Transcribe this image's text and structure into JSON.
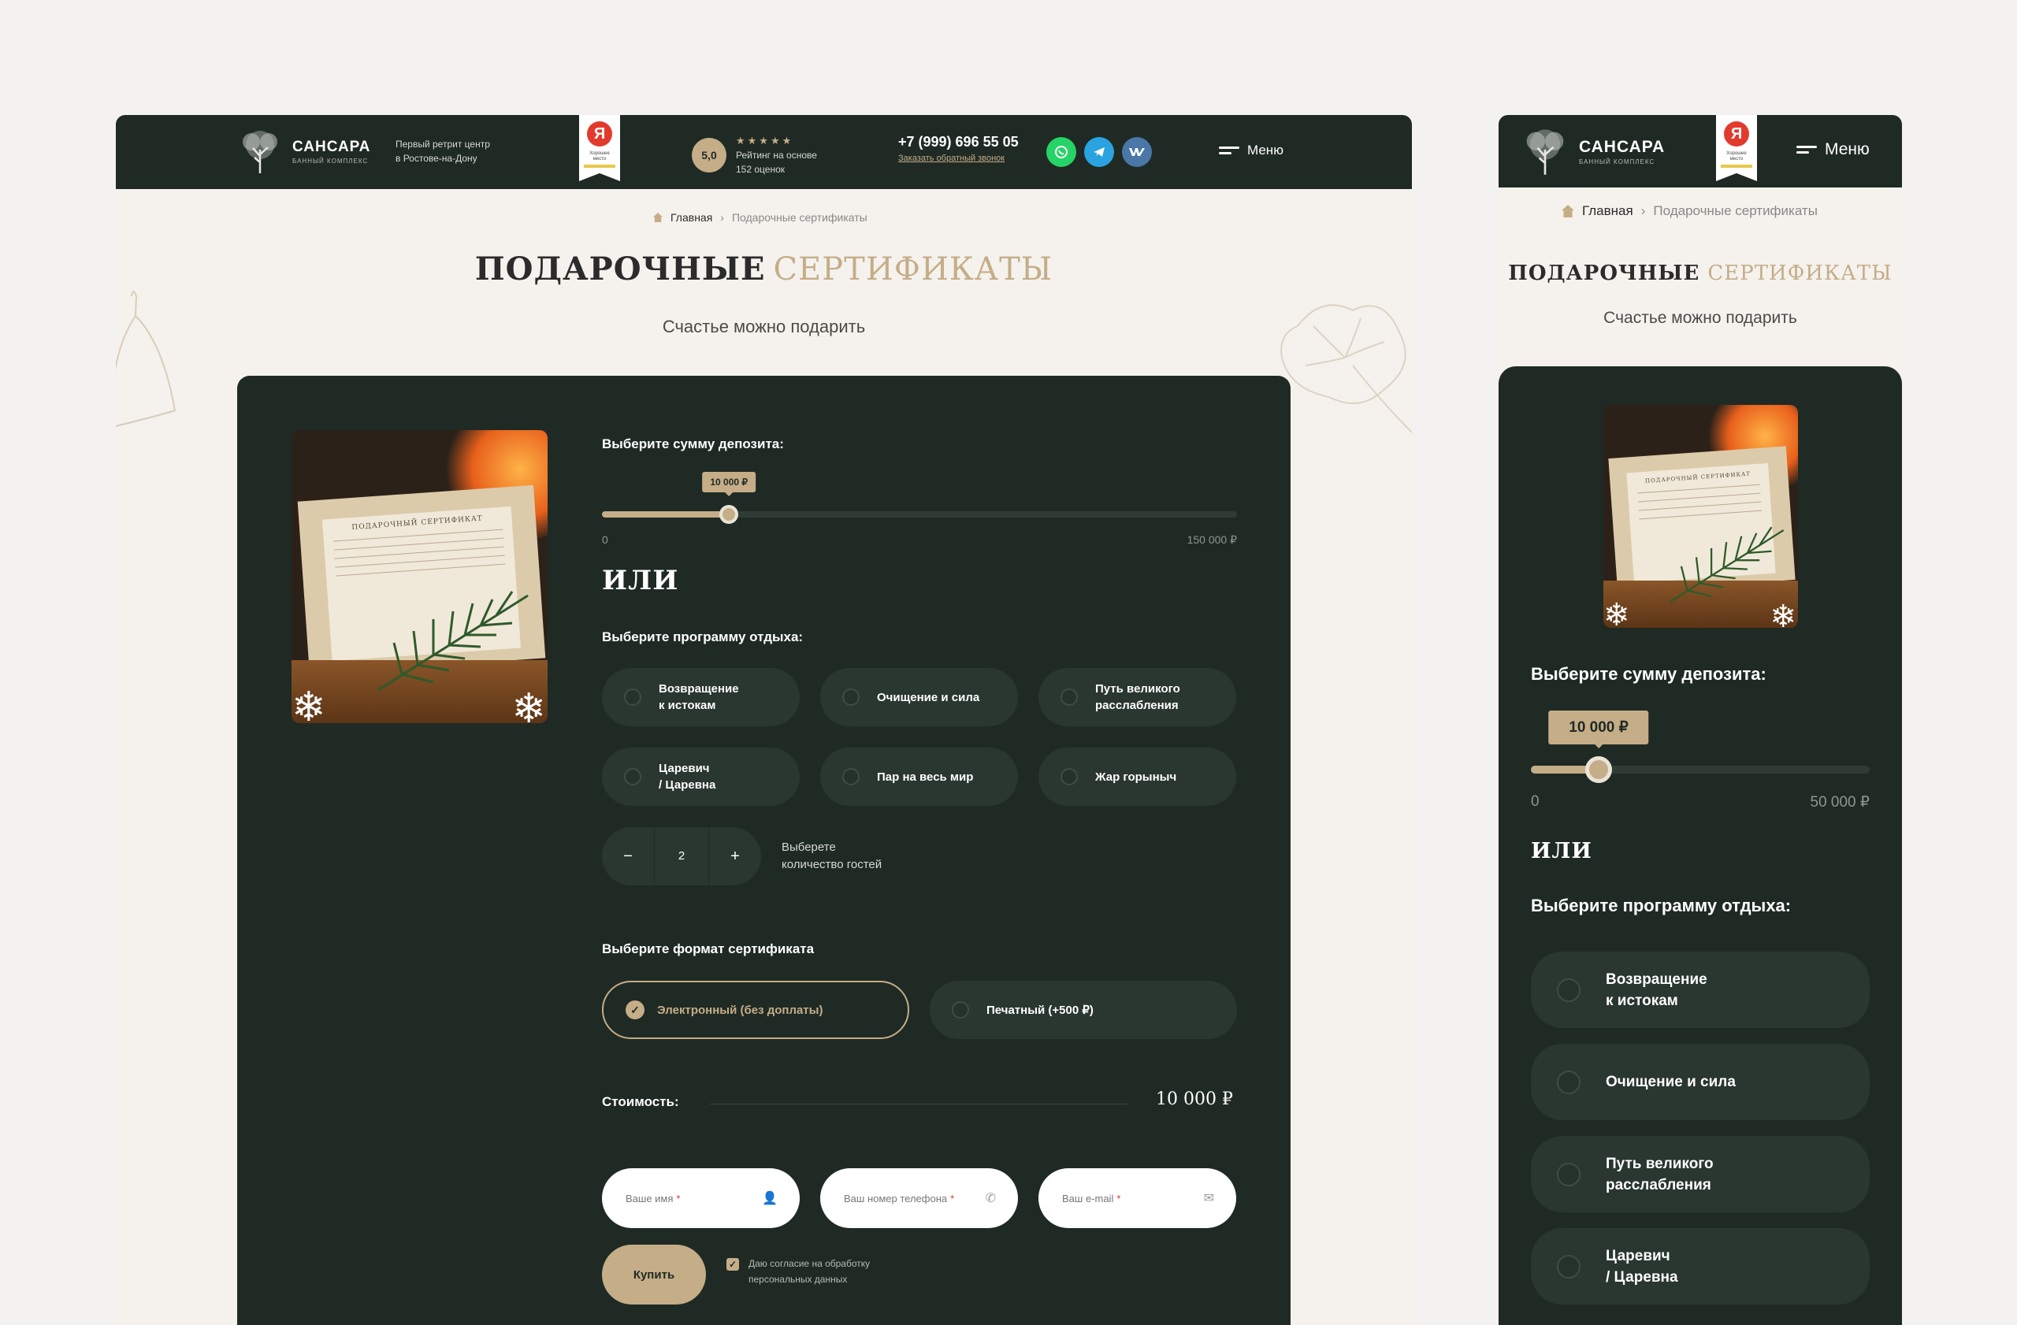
{
  "brand": {
    "name": "САНСАРА",
    "sub": "БАННЫЙ КОМПЛЕКС",
    "tagline": [
      "Первый ретрит центр",
      "в Ростове-на-Дону"
    ]
  },
  "yandex": {
    "letter": "Я",
    "badge": [
      "Хорошее",
      "место"
    ]
  },
  "rating": {
    "value": "5,0",
    "stars": "★★★★★",
    "lines": [
      "Рейтинг на основе",
      "152 оценок"
    ]
  },
  "contact": {
    "phone": "+7 (999) 696 55 05",
    "callback": "Заказать обратный звонок"
  },
  "socials": [
    {
      "icon": "whatsapp-icon",
      "color": "#25d366"
    },
    {
      "icon": "telegram-icon",
      "color": "#2aa3e0"
    },
    {
      "icon": "vk-icon",
      "color": "#4a76a8"
    }
  ],
  "menu_label": "Меню",
  "breadcrumb": {
    "home": "Главная",
    "current": "Подарочные сертификаты"
  },
  "title": {
    "dark": "ПОДАРОЧНЫЕ",
    "gold": "СЕРТИФИКАТЫ"
  },
  "subtitle": "Счастье можно подарить",
  "certificate_card": {
    "title": "ПОДАРОЧНЫЙ СЕРТИФИКАТ"
  },
  "deposit": {
    "label": "Выберите сумму депозита:",
    "value_label": "10 000 ₽",
    "value": 10000,
    "min_label": "0",
    "desktop_max_label": "150 000 ₽",
    "desktop_max": 150000,
    "mobile_max_label": "50 000 ₽",
    "mobile_max": 50000
  },
  "or_label": "ИЛИ",
  "program": {
    "label": "Выберите программу отдыха:",
    "options": [
      [
        "Возвращение",
        "к истокам"
      ],
      [
        "Очищение и сила"
      ],
      [
        "Путь великого",
        "расслабления"
      ],
      [
        "Царевич",
        "/ Царевна"
      ],
      [
        "Пар на весь мир"
      ],
      [
        "Жар горыныч"
      ]
    ]
  },
  "guests": {
    "minus": "−",
    "value": "2",
    "plus": "+",
    "note": [
      "Выберете",
      "количество гостей"
    ]
  },
  "format": {
    "label": "Выберите формат сертификата",
    "electronic": "Электронный (без доплаты)",
    "printed": "Печатный (+500 ₽)"
  },
  "cost": {
    "label": "Стоимость:",
    "value": "10 000 ₽"
  },
  "form": {
    "name": "Ваше имя",
    "phone": "Ваш номер телефона",
    "email": "Ваш e-mail",
    "required_mark": "*",
    "buy": "Купить",
    "consent": [
      "Даю согласие на обработку",
      "персональных данных"
    ]
  },
  "colors": {
    "dark": "#1f2a24",
    "gold": "#c5ad88",
    "page_bg": "#f5f2ed"
  }
}
